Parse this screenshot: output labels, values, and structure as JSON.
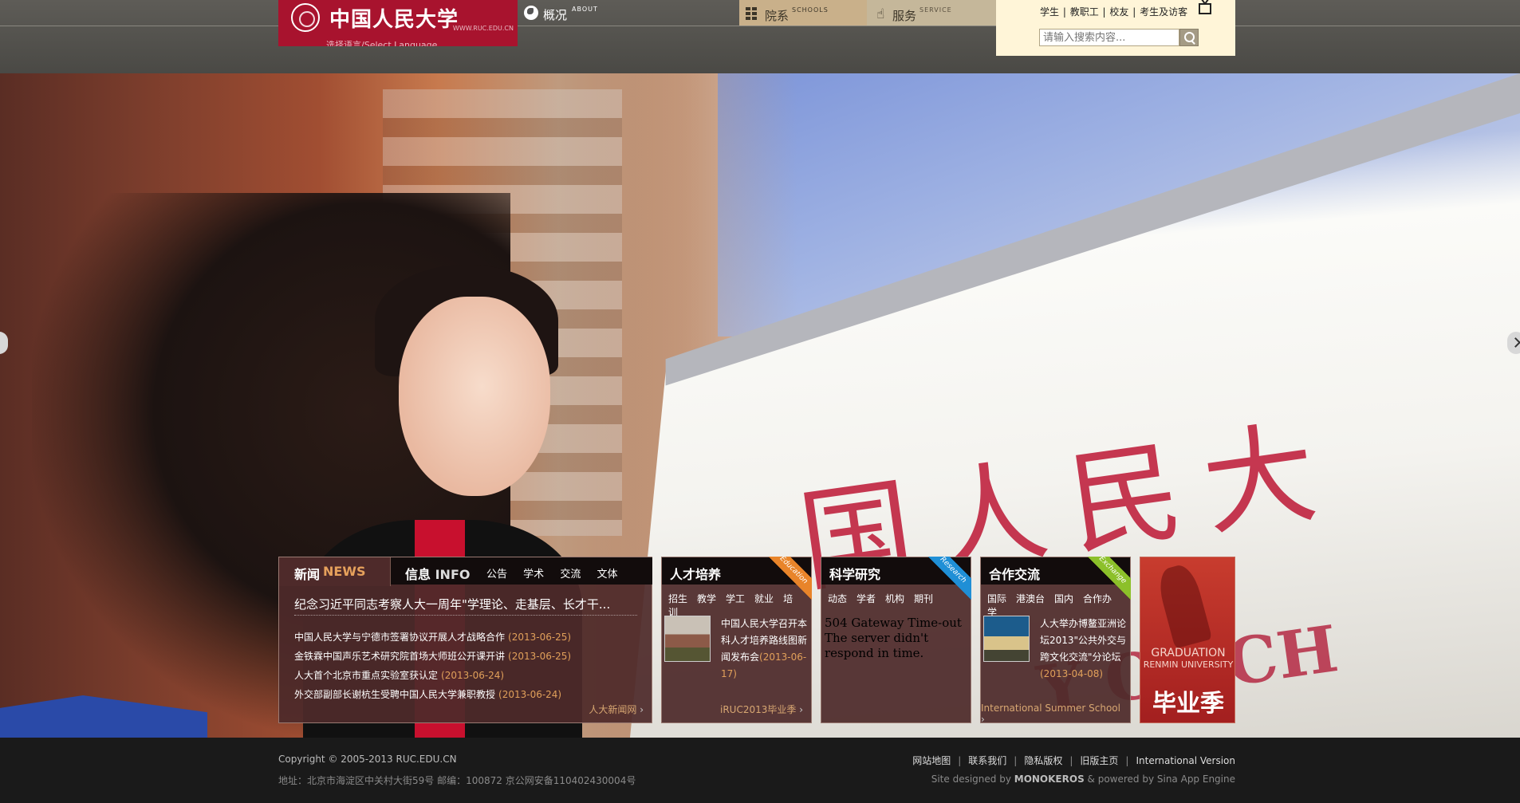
{
  "header": {
    "logo_name": "中国人民大学",
    "logo_domain": "WWW.RUC.EDU.CN",
    "language_select": "选择语言/Select Language",
    "nav": [
      {
        "zh": "概况",
        "en": "ABOUT"
      },
      {
        "zh": "院系",
        "en": "SCHOOLS"
      },
      {
        "zh": "服务",
        "en": "SERVICE"
      }
    ],
    "user_links": [
      "学生",
      "教职工",
      "校友",
      "考生及访客"
    ],
    "search_placeholder": "请输入搜索内容..."
  },
  "news": {
    "tab_news_zh": "新闻",
    "tab_news_en": "NEWS",
    "tab_info_zh": "信息",
    "tab_info_en": "INFO",
    "subtabs": [
      "公告",
      "学术",
      "交流",
      "文体"
    ],
    "headline": "纪念习近平同志考察人大一周年\"学理论、走基层、长才干...",
    "items": [
      {
        "title": "中国人民大学与宁德市签署协议开展人才战略合作",
        "date": "(2013-06-25)"
      },
      {
        "title": "金铁霖中国声乐艺术研究院首场大师班公开课开讲",
        "date": "(2013-06-25)"
      },
      {
        "title": "人大首个北京市重点实验室获认定",
        "date": "(2013-06-24)"
      },
      {
        "title": "外交部副部长谢杭生受聘中国人民大学兼职教授",
        "date": "(2013-06-24)"
      }
    ],
    "more": "人大新闻网"
  },
  "education": {
    "title": "人才培养",
    "ribbon": "Education",
    "subtabs": [
      "招生",
      "教学",
      "学工",
      "就业",
      "培训"
    ],
    "text": "中国人民大学召开本科人才培养路线图新闻发布会",
    "date": "(2013-06-17)",
    "more": "iRUC2013毕业季"
  },
  "research": {
    "title": "科学研究",
    "ribbon": "Research",
    "subtabs": [
      "动态",
      "学者",
      "机构",
      "期刊"
    ],
    "error": "504 Gateway Time-out The server didn't respond in time."
  },
  "exchange": {
    "title": "合作交流",
    "ribbon": "Exchange",
    "subtabs": [
      "国际",
      "港澳台",
      "国内",
      "合作办学"
    ],
    "text": "人大举办博鳌亚洲论坛2013\"公共外交与跨文化交流\"分论坛",
    "date": "(2013-04-08)",
    "more": "International Summer School"
  },
  "graduation": {
    "line1": "GRADUATION",
    "line2": "RENMIN UNIVERSITY",
    "line3": "毕业季"
  },
  "footer": {
    "copyright": "Copyright © 2005-2013 RUC.EDU.CN",
    "address": "地址：北京市海淀区中关村大街59号 邮编：100872 京公网安备110402430004号",
    "links": [
      "网站地图",
      "联系我们",
      "隐私版权",
      "旧版主页",
      "International Version"
    ],
    "credit_prefix": "Site designed by ",
    "credit_brand": "MONOKEROS",
    "credit_suffix": " & powered by Sina App Engine"
  },
  "colors": {
    "brand": "#a8132e",
    "panel": "#4e2a2a",
    "accent_date": "#e1a05a"
  },
  "icons": [
    "globe-icon",
    "grid-icon",
    "hand-icon",
    "tv-icon",
    "search-icon",
    "arrow-left-icon",
    "arrow-right-icon"
  ]
}
